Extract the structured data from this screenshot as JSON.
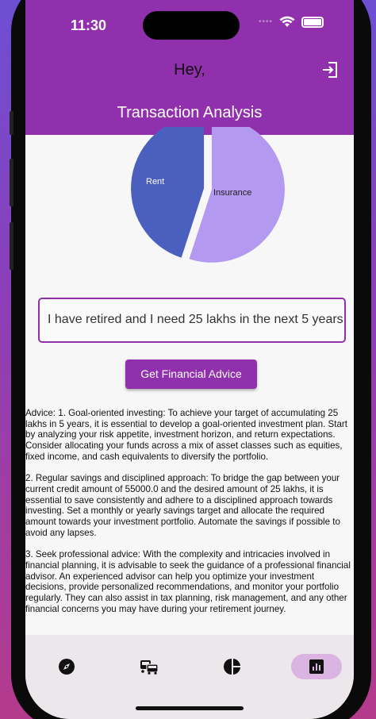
{
  "status_bar": {
    "time": "11:30",
    "signal": "••••"
  },
  "header": {
    "greeting": "Hey,",
    "title": "Transaction Analysis",
    "logout_icon": "logout-icon"
  },
  "chart_data": {
    "type": "pie",
    "labels": [
      "Rent",
      "Insurance"
    ],
    "values": [
      45,
      55
    ],
    "colors": [
      "#4b5fbf",
      "#b39af0"
    ],
    "label_colors": [
      "#ffffff",
      "#222222"
    ]
  },
  "query": {
    "value": "I have retired and I need 25 lakhs in the next 5 years"
  },
  "advice_button": {
    "label": "Get Financial Advice"
  },
  "advice": {
    "paragraphs": [
      "Advice: 1. Goal-oriented investing: To achieve your target of accumulating 25 lakhs in 5 years, it is essential to develop a goal-oriented investment plan. Start by analyzing your risk appetite, investment horizon, and return expectations. Consider allocating your funds across a mix of asset classes such as equities, fixed income, and cash equivalents to diversify the portfolio.",
      "2. Regular savings and disciplined approach: To bridge the gap between your current credit amount of 55000.0 and the desired amount of 25 lakhs, it is essential to save consistently and adhere to a disciplined approach towards investing. Set a monthly or yearly savings target and allocate the required amount towards your investment portfolio. Automate the savings if possible to avoid any lapses.",
      "3. Seek professional advice: With the complexity and intricacies involved in financial planning, it is advisable to seek the guidance of a professional financial advisor. An experienced advisor can help you optimize your investment decisions, provide personalized recommendations, and monitor your portfolio regularly. They can also assist in tax planning, risk management, and any other financial concerns you may have during your retirement journey."
    ]
  },
  "bottom_nav": {
    "items": [
      {
        "icon": "compass-icon",
        "active": false
      },
      {
        "icon": "transactions-icon",
        "active": false
      },
      {
        "icon": "pie-chart-icon",
        "active": false
      },
      {
        "icon": "analytics-icon",
        "active": true
      }
    ]
  },
  "colors": {
    "primary": "#9130ac",
    "active_indicator": "#dbb5e1",
    "nav_bg": "#ebe7eb"
  }
}
